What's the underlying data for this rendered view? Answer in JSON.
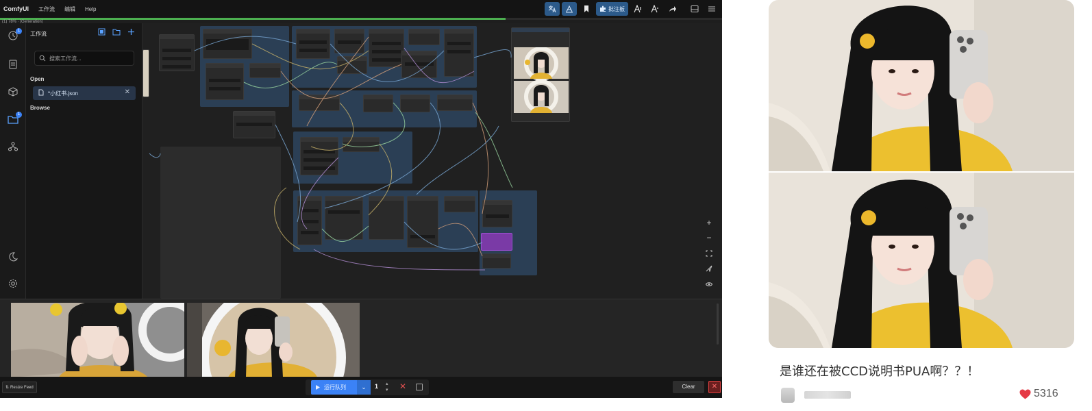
{
  "comfy": {
    "brand": "ComfyUI",
    "menu": [
      "工作流",
      "编辑",
      "Help"
    ],
    "toolbar": {
      "run_label": "批注板"
    },
    "status": "(1) 78% · [Generation]",
    "progress_fraction": 0.7,
    "sidebar_badges": {
      "queue": "1",
      "workflows": "1"
    },
    "workflows_panel": {
      "title": "工作流",
      "search_placeholder": "搜索工作流...",
      "open_label": "Open",
      "browse_label": "Browse",
      "open_files": [
        "*小红书.json"
      ]
    },
    "bottom": {
      "resize_label": "Resize Feed",
      "queue_label": "运行队列",
      "batch_count": "1",
      "clear_label": "Clear"
    }
  },
  "post": {
    "caption": "是谁还在被CCD说明书PUA啊？？！",
    "likes": "5316"
  },
  "colors": {
    "comfy_bg": "#1e1e1e",
    "accent_blue": "#3b82f6",
    "progress_green": "#4caf50",
    "like_red": "#e53945",
    "sweater_yellow": "#e9b82e"
  }
}
